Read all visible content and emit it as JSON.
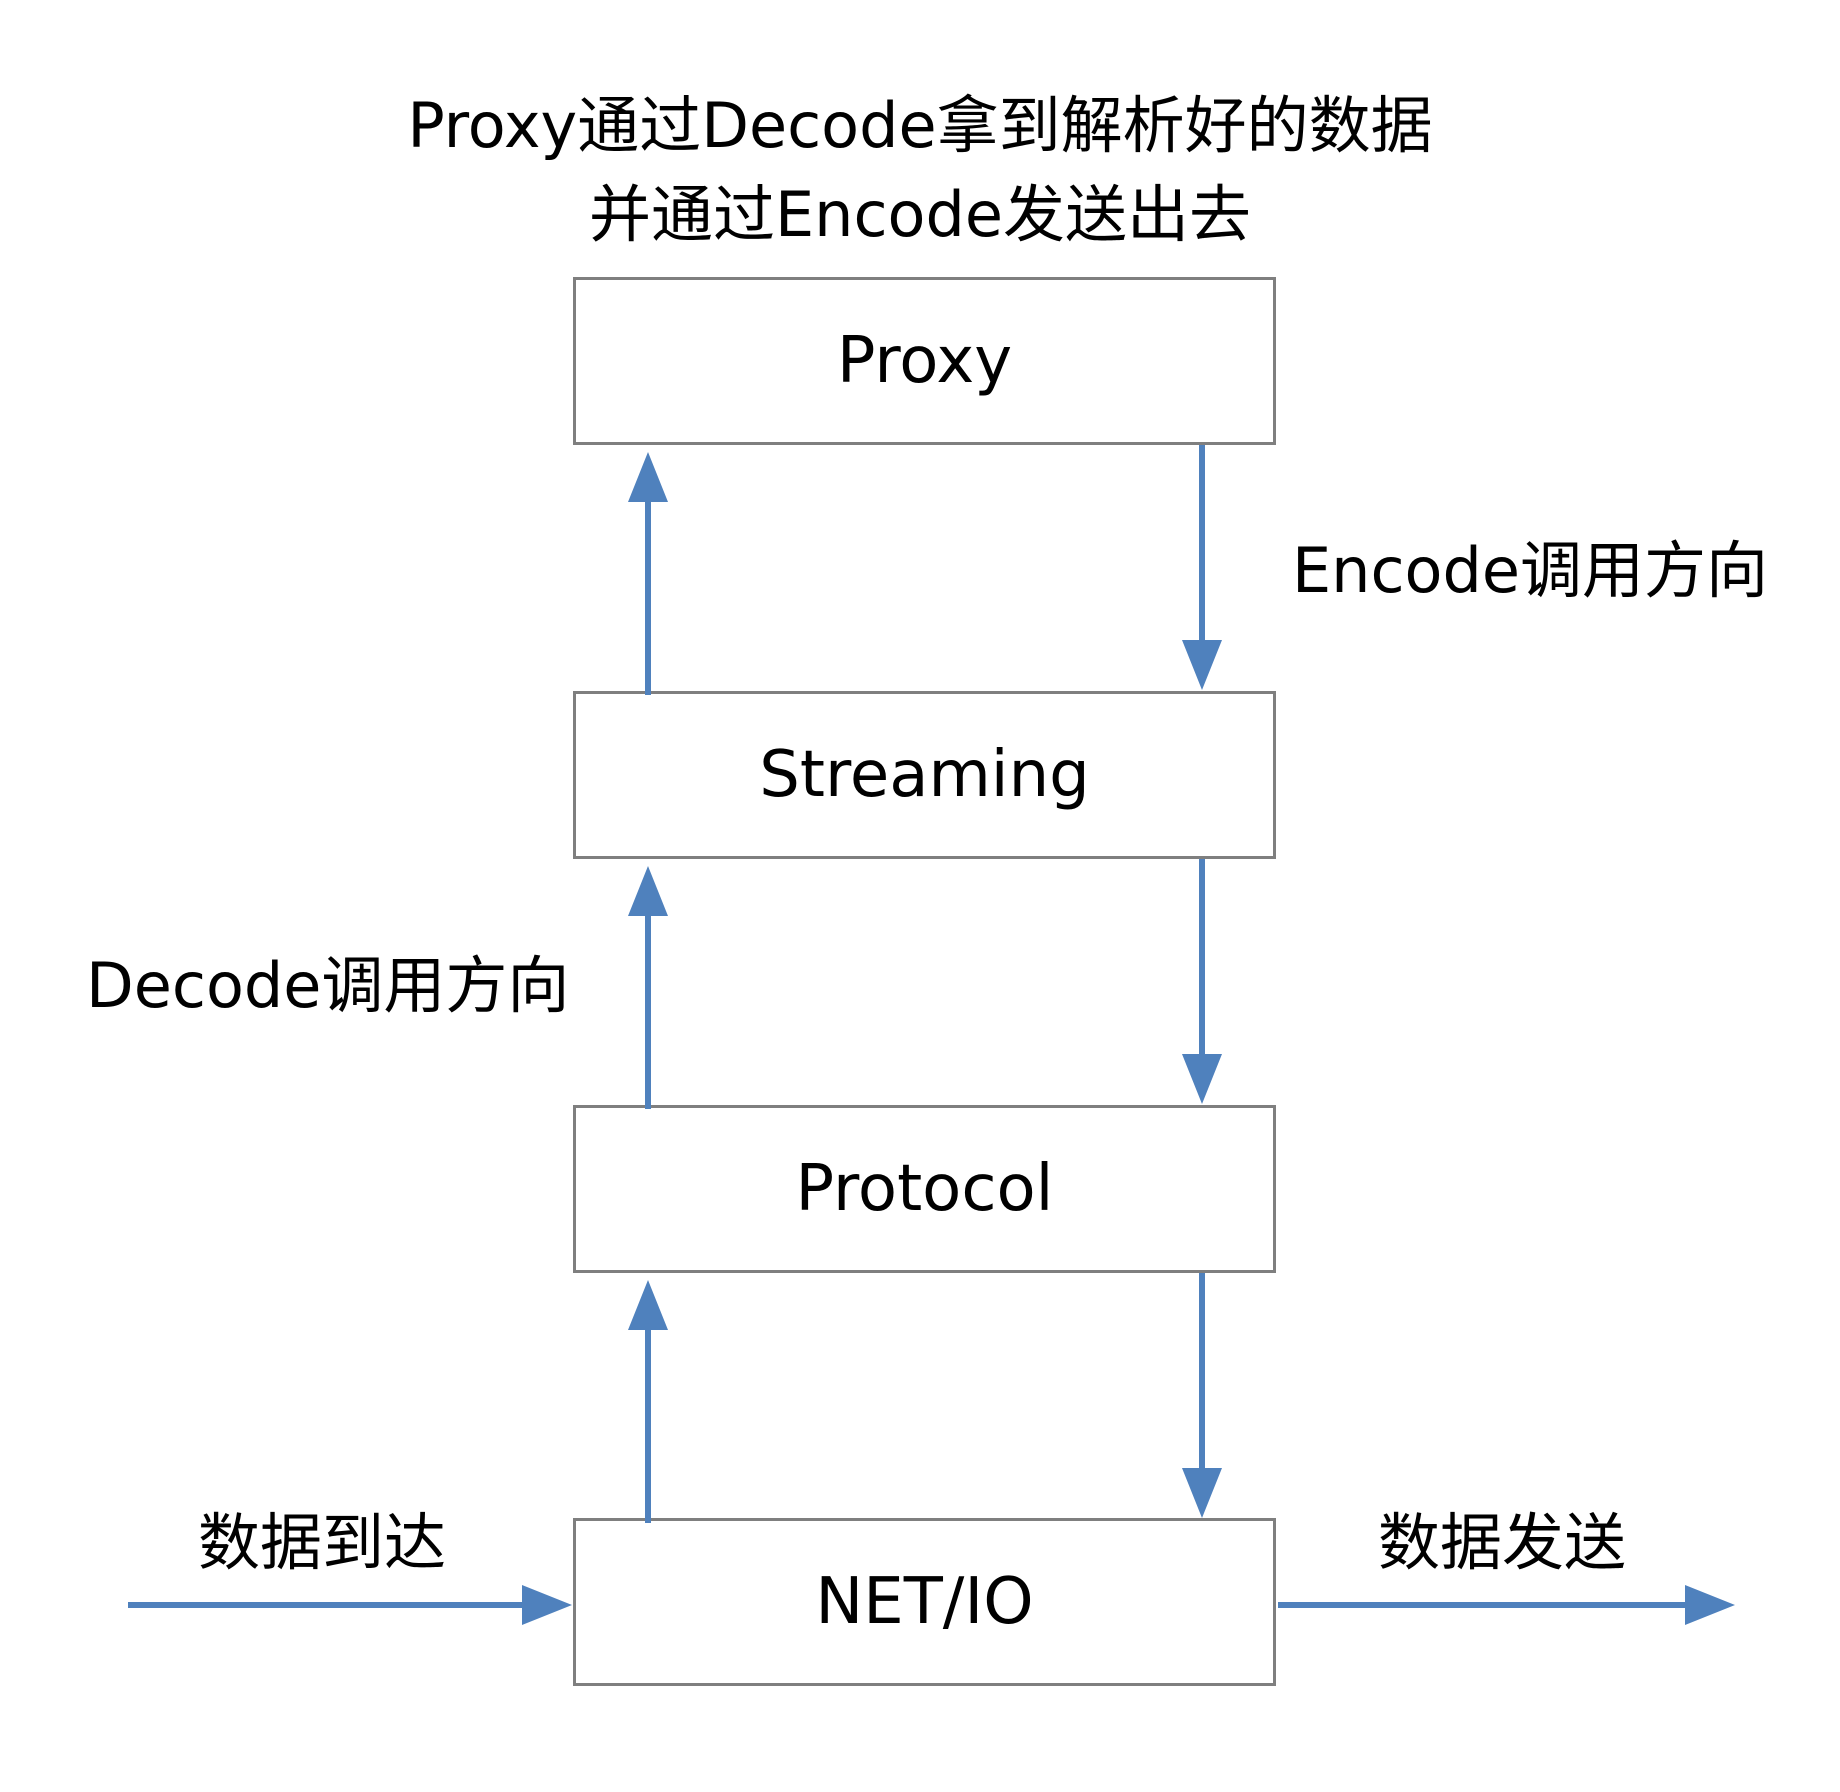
{
  "caption": {
    "line1": "Proxy通过Decode拿到解析好的数据",
    "line2": "并通过Encode发送出去"
  },
  "layers": {
    "proxy": "Proxy",
    "streaming": "Streaming",
    "protocol": "Protocol",
    "netio": "NET/IO"
  },
  "labels": {
    "encode_direction": "Encode调用方向",
    "decode_direction": "Decode调用方向",
    "data_arrive": "数据到达",
    "data_send": "数据发送"
  },
  "colors": {
    "arrow": "#4f81bd",
    "box_border": "#7f7f7f"
  }
}
